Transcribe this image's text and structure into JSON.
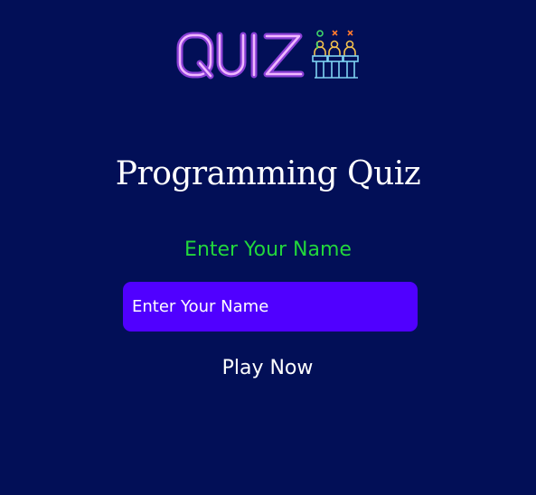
{
  "logo": {
    "text": "QUIZ",
    "icon": "quiz-contestants-icon"
  },
  "header": {
    "title": "Programming Quiz"
  },
  "form": {
    "label": "Enter Your Name",
    "name_placeholder": "Enter Your Name",
    "name_value": "",
    "play_label": "Play Now"
  },
  "colors": {
    "background": "#020f57",
    "logo_neon": "#b060ef",
    "label_green": "#22d63c",
    "input_background": "#5000ff",
    "text_white": "#ffffff"
  }
}
